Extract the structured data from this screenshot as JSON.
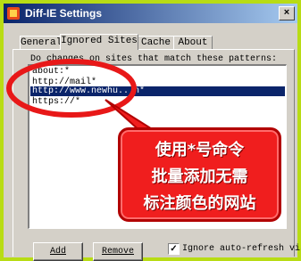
{
  "window": {
    "title": "Diff-IE Settings",
    "close_glyph": "×",
    "app_icon": "diff-ie-app-icon"
  },
  "tabs": [
    {
      "label": "General",
      "active": false
    },
    {
      "label": "Ignored Sites",
      "active": true
    },
    {
      "label": "Cache",
      "active": false
    },
    {
      "label": "About",
      "active": false
    }
  ],
  "panel": {
    "description": "Do      changes on sites that match these patterns:",
    "patterns": [
      "about:*",
      "http://mail*",
      "http://www.newhu...n*",
      "https://*"
    ],
    "selected_index": 2
  },
  "buttons": {
    "add": "Add",
    "remove": "Remove"
  },
  "checkbox": {
    "label": "Ignore auto-refresh visi",
    "checked": true,
    "check_glyph": "✓"
  },
  "annotation": {
    "lines": [
      "使用*号命令",
      "批量添加无需",
      "标注颜色的网站"
    ],
    "colors": {
      "fill": "#f01e1e",
      "border": "#b20000",
      "text": "#ffffff",
      "ring": "#e81818"
    }
  },
  "colors": {
    "frame": "#b8dc14",
    "selection": "#0a246a",
    "face": "#d4d0c8"
  }
}
